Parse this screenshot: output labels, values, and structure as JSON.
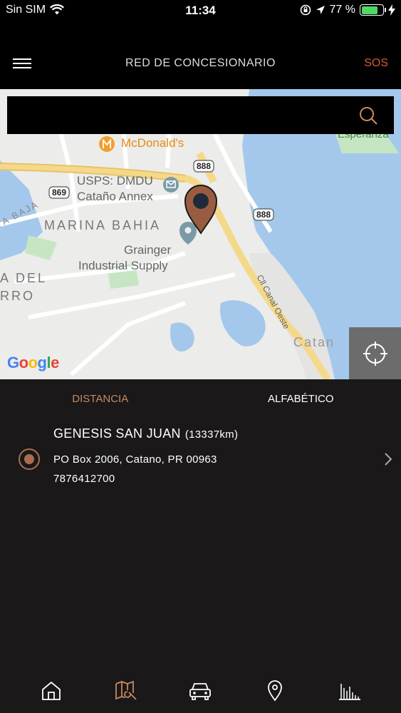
{
  "status_bar": {
    "carrier": "Sin SIM",
    "time": "11:34",
    "battery_percent": "77 %",
    "battery_level": 0.77
  },
  "header": {
    "title": "RED DE CONCESIONARIO",
    "sos_label": "SOS"
  },
  "search": {
    "value": "",
    "placeholder": ""
  },
  "map": {
    "labels": {
      "mcdonalds": "McDonald's",
      "usps_line1": "USPS: DMDU",
      "usps_line2": "Cataño Annex",
      "marina_bahia": "MARINA BAHIA",
      "grainger_line1": "Grainger",
      "grainger_line2": "Industrial Supply",
      "canal_oeste": "Cll Canal Oeste",
      "catano": "Catan",
      "la_baja": "A BAJA",
      "del": "A DEL",
      "rro": "RRO",
      "esperanza": "Esperanza",
      "road_888_a": "888",
      "road_888_b": "888",
      "road_869": "869"
    },
    "google_logo": "Google"
  },
  "tabs": [
    {
      "label": "DISTANCIA",
      "active": true
    },
    {
      "label": "ALFABÉTICO",
      "active": false
    }
  ],
  "dealers": [
    {
      "name": "GENESIS SAN JUAN",
      "distance": "(13337km)",
      "address": "PO Box 2006, Catano, PR 00963",
      "phone": "7876412700",
      "selected": true
    }
  ],
  "bottom_nav": [
    {
      "icon": "home-icon",
      "active": false
    },
    {
      "icon": "map-service-icon",
      "active": true
    },
    {
      "icon": "car-icon",
      "active": false
    },
    {
      "icon": "location-pin-icon",
      "active": false
    },
    {
      "icon": "chart-icon",
      "active": false
    }
  ],
  "colors": {
    "accent": "#c8895f",
    "sos": "#d9573a",
    "marker": "#9a5c40",
    "background": "#1a1819"
  }
}
